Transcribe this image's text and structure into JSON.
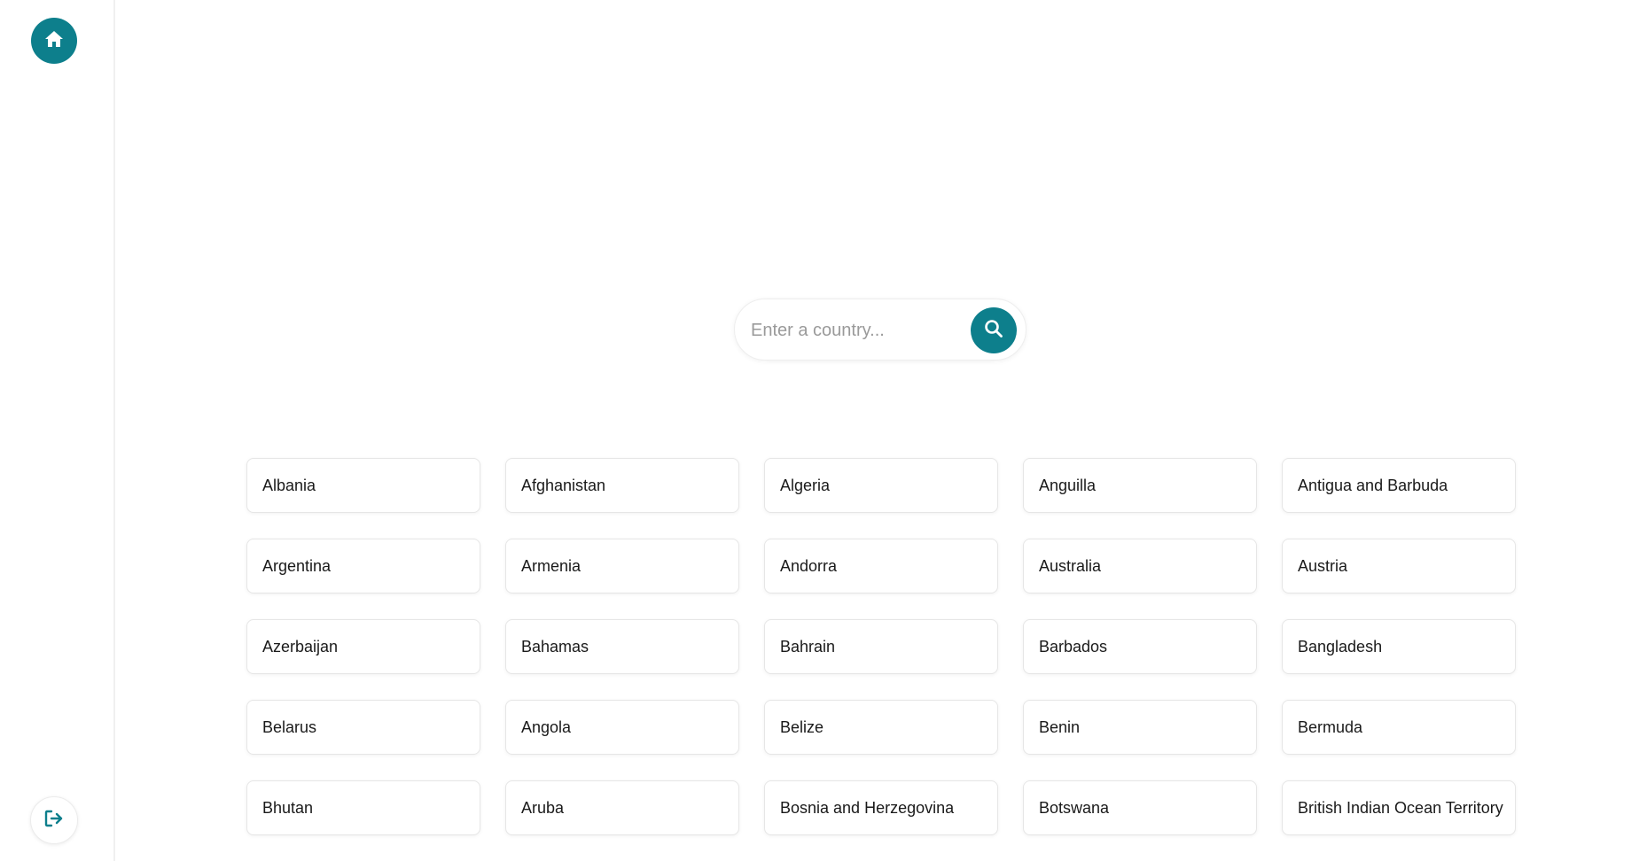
{
  "sidebar": {
    "home_icon": "home-icon",
    "logout_icon": "logout-icon"
  },
  "search": {
    "placeholder": "Enter a country...",
    "value": "",
    "button_icon": "search-icon"
  },
  "countries": [
    "Albania",
    "Afghanistan",
    "Algeria",
    "Anguilla",
    "Antigua and Barbuda",
    "Argentina",
    "Armenia",
    "Andorra",
    "Australia",
    "Austria",
    "Azerbaijan",
    "Bahamas",
    "Bahrain",
    "Barbados",
    "Bangladesh",
    "Belarus",
    "Angola",
    "Belize",
    "Benin",
    "Bermuda",
    "Bhutan",
    "Aruba",
    "Bosnia and Herzegovina",
    "Botswana",
    "British Indian Ocean Territory"
  ],
  "colors": {
    "accent": "#0d7f8c",
    "border": "#e6e6e6",
    "text": "#1a1a1a",
    "placeholder": "#9a9a9a"
  }
}
